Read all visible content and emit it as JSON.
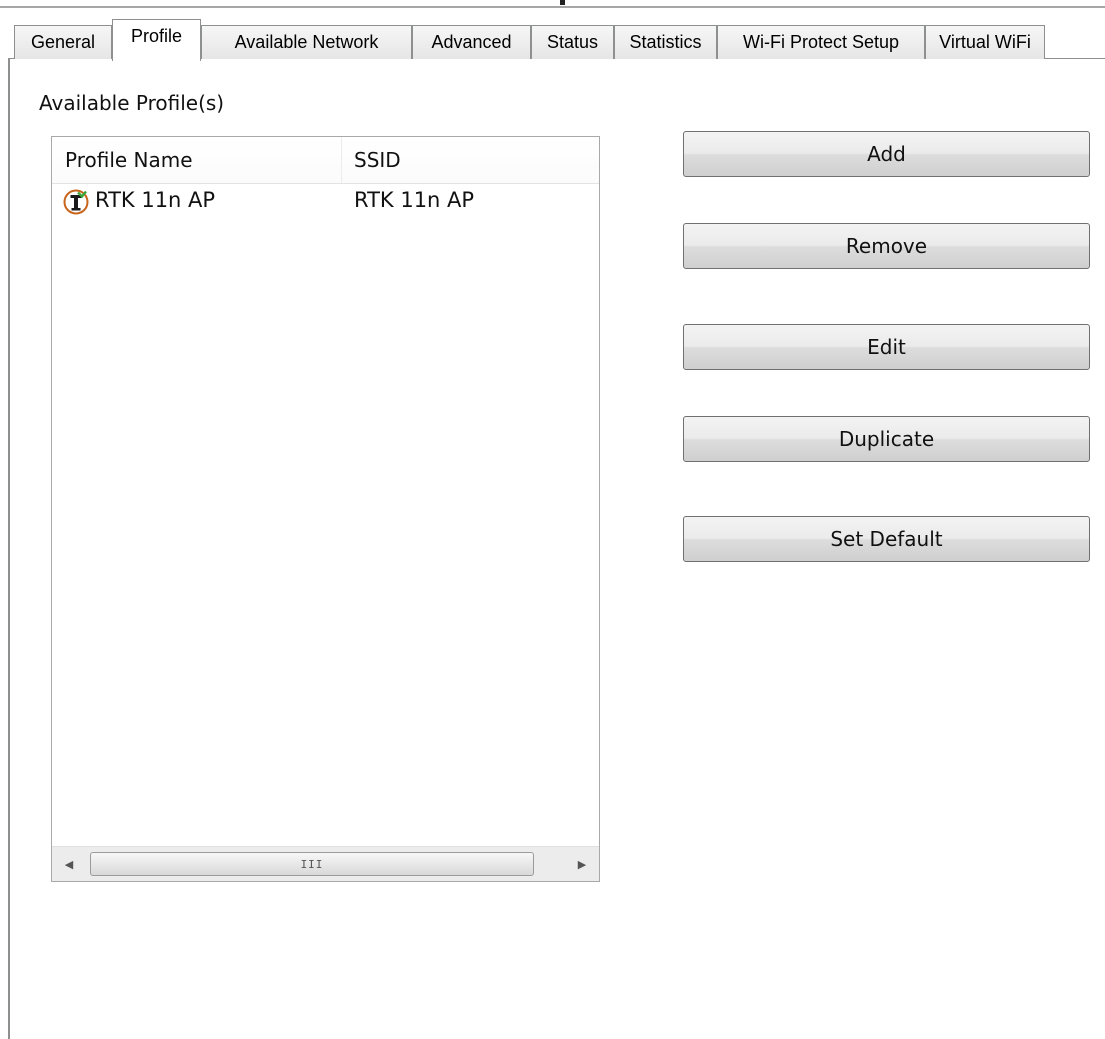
{
  "tabs": [
    {
      "label": "General"
    },
    {
      "label": "Profile",
      "active": true
    },
    {
      "label": "Available Network"
    },
    {
      "label": "Advanced"
    },
    {
      "label": "Status"
    },
    {
      "label": "Statistics"
    },
    {
      "label": "Wi-Fi Protect Setup"
    },
    {
      "label": "Virtual WiFi"
    }
  ],
  "profile_section": {
    "title": "Available Profile(s)",
    "columns": {
      "name": "Profile Name",
      "ssid": "SSID"
    },
    "rows": [
      {
        "name": "RTK 11n AP",
        "ssid": "RTK 11n AP",
        "icon": "wireless-profile-icon"
      }
    ],
    "scrollbar_grip": "III"
  },
  "buttons": {
    "add": "Add",
    "remove": "Remove",
    "edit": "Edit",
    "duplicate": "Duplicate",
    "set_default": "Set Default"
  }
}
